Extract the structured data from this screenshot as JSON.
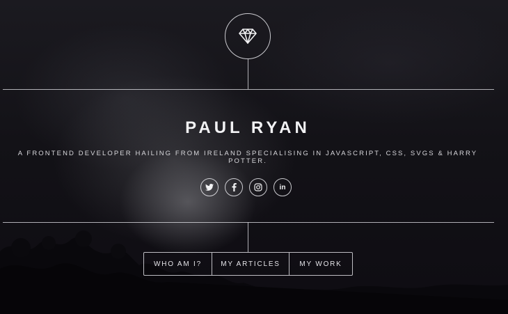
{
  "hero": {
    "logo_icon": "diamond-icon",
    "name": "PAUL RYAN",
    "tagline": "A FRONTEND DEVELOPER HAILING FROM IRELAND SPECIALISING IN JAVASCRIPT, CSS, SVGS & HARRY POTTER."
  },
  "socials": [
    {
      "icon": "twitter-icon"
    },
    {
      "icon": "facebook-icon"
    },
    {
      "icon": "instagram-icon"
    },
    {
      "icon": "linkedin-icon",
      "text": "in"
    }
  ],
  "nav": {
    "items": [
      {
        "label": "WHO AM I?"
      },
      {
        "label": "MY ARTICLES"
      },
      {
        "label": "MY WORK"
      }
    ]
  },
  "colors": {
    "background": "#0d0b10",
    "line": "#e6e6eb",
    "text": "#f2f2f4"
  }
}
